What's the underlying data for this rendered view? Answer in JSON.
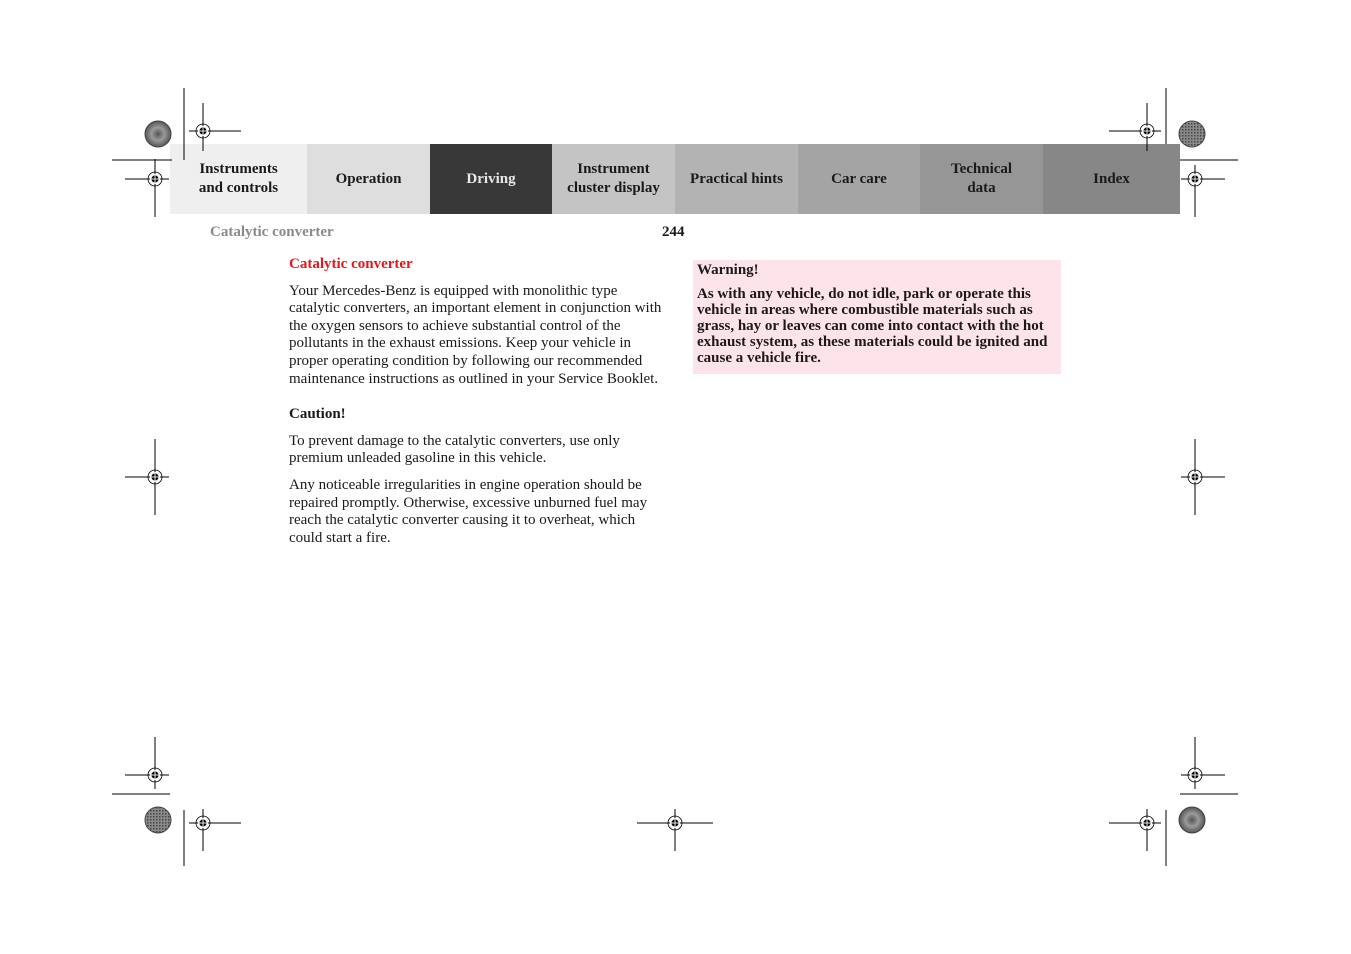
{
  "tabs": [
    {
      "label_line1": "Instruments",
      "label_line2": "and controls",
      "bg": "#efefef",
      "active": false
    },
    {
      "label_line1": "Operation",
      "label_line2": "",
      "bg": "#dedede",
      "active": false
    },
    {
      "label_line1": "Driving",
      "label_line2": "",
      "bg": "#383838",
      "active": true
    },
    {
      "label_line1": "Instrument",
      "label_line2": "cluster display",
      "bg": "#c4c4c4",
      "active": false
    },
    {
      "label_line1": "Practical hints",
      "label_line2": "",
      "bg": "#b3b3b3",
      "active": false
    },
    {
      "label_line1": "Car care",
      "label_line2": "",
      "bg": "#a4a4a4",
      "active": false
    },
    {
      "label_line1": "Technical",
      "label_line2": "data",
      "bg": "#969696",
      "active": false
    },
    {
      "label_line1": "Index",
      "label_line2": "",
      "bg": "#878787",
      "active": false
    }
  ],
  "header": {
    "section_title": "Catalytic converter",
    "page_number": "244"
  },
  "content": {
    "heading": "Catalytic converter",
    "intro": "Your Mercedes-Benz is equipped with monolithic type catalytic converters, an important element in conjunction with the oxygen sensors to achieve substantial control of the pollutants in the exhaust emissions. Keep your vehicle in proper operating condition by following our recommended maintenance instructions as outlined in your Service Booklet.",
    "caution_title": "Caution!",
    "caution_paragraphs": [
      "To prevent damage to the catalytic converters, use only premium unleaded gasoline in this vehicle.",
      "Any noticeable irregularities in engine operation should be repaired promptly. Otherwise, excessive unburned fuel may reach the catalytic converter causing it to overheat, which could start a fire."
    ]
  },
  "warning": {
    "title": "Warning!",
    "body": "As with any vehicle, do not idle, park or operate this vehicle in areas where combustible materials such as grass, hay or leaves can come into contact with the hot exhaust system, as these materials could be ignited and cause a vehicle fire.",
    "bg": "#fde4eb"
  },
  "colors": {
    "heading_red": "#e8141c",
    "section_gray": "#8a8a8a"
  }
}
